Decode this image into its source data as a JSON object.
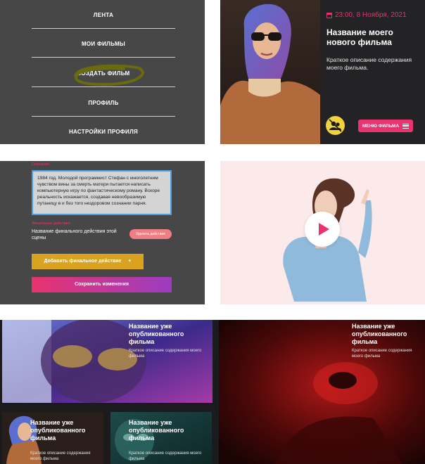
{
  "menu": {
    "items": [
      {
        "label": "ЛЕНТА"
      },
      {
        "label": "МОИ ФИЛЬМЫ"
      },
      {
        "label": "СОЗДАТЬ ФИЛЬМ"
      },
      {
        "label": "ПРОФИЛЬ"
      },
      {
        "label": "НАСТРОЙКИ ПРОФИЛЯ"
      }
    ],
    "highlight_color": "#6a6a10"
  },
  "film_card": {
    "date": "23:00, 8 Ноября, 2021",
    "title": "Название моего нового фильма",
    "description": "Краткое описание содержания моего фильма.",
    "menu_button": "МЕНЮ ФИЛЬМА",
    "accent_color": "#e8336f",
    "badge_color": "#f2d33e",
    "badge_icon": "group-icon"
  },
  "edit_form": {
    "description_label": "Описание",
    "description_text": "1984 год. Молодой программист Стефан с многолетним чувством вины за смерть матери пытается написать компьютерную игру по фантастическому роману. Вскоре реальность искажается, создавая невообразимую путаницу в и без того нездоровом сознании парня.",
    "final_actions_label": "Финальные действия",
    "final_action_name": "Название финального действия этой сцены",
    "delete_button": "Удалить действие",
    "add_button": "Добавить финальное действие",
    "add_button_icon": "+",
    "save_button": "Сохранить изменения"
  },
  "video_preview": {
    "play_icon": "play-icon",
    "background_color": "#fce9ea"
  },
  "film_grid": {
    "tiles": [
      {
        "title": "Название уже опубликованного фильма",
        "description": "Краткое описание содержания моего фильма"
      },
      {
        "title": "Название уже опубликованного фильма",
        "description": "Краткое описание содержания моего фильма"
      },
      {
        "title": "Название уже опубликованного фильма",
        "description": "Краткое описание содержания моего фильма"
      },
      {
        "title": "Название уже опубликованного фильма",
        "description": "Краткое описание содержания моего фильма"
      }
    ]
  }
}
